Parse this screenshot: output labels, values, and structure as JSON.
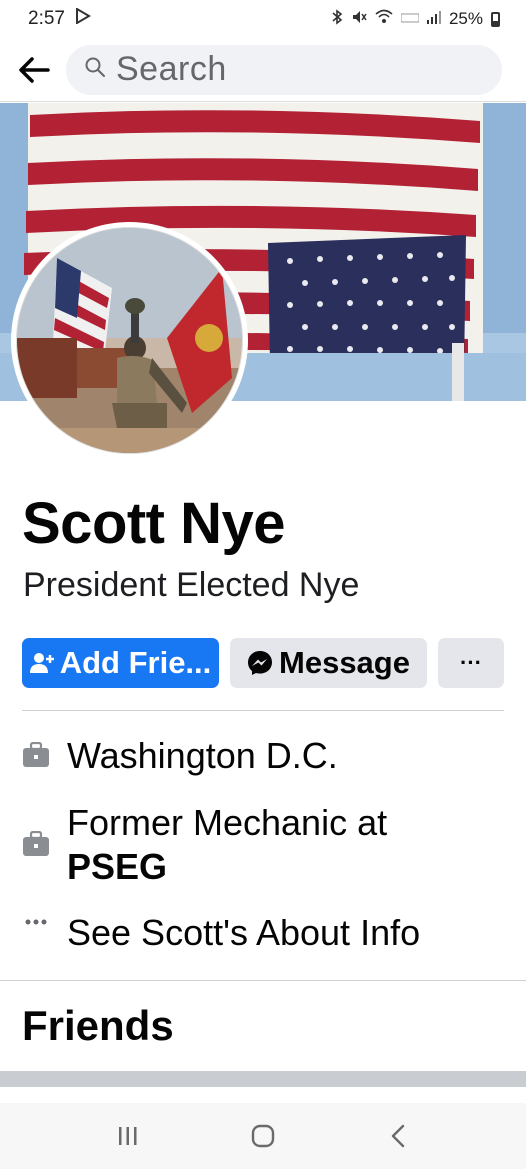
{
  "status_bar": {
    "time": "2:57",
    "battery": "25%",
    "icons": [
      "play-store-icon",
      "bluetooth-icon",
      "mute-icon",
      "wifi-icon",
      "volte-icon",
      "signal-icon",
      "battery-icon"
    ]
  },
  "search": {
    "placeholder": "Search"
  },
  "profile": {
    "name": "Scott Nye",
    "subtitle": "President Elected Nye"
  },
  "actions": {
    "add_friend": "Add Frie...",
    "message": "Message",
    "more": "···"
  },
  "info": {
    "location": "Washington D.C.",
    "work_prefix": "Former Mechanic at",
    "work_company": "PSEG",
    "about": "See Scott's About Info"
  },
  "sections": {
    "friends": "Friends"
  },
  "colors": {
    "primary": "#1877f2",
    "button_gray": "#e4e6eb",
    "background_gray": "#f0f2f5",
    "text": "#050505"
  }
}
